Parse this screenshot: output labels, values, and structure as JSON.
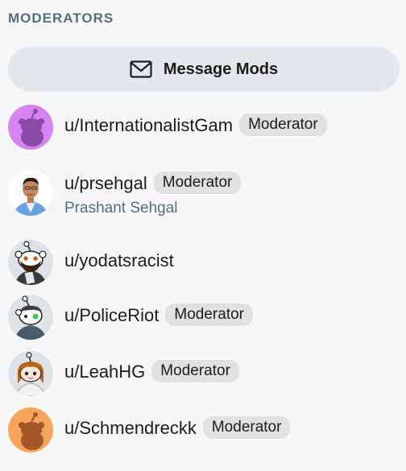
{
  "section": {
    "title": "MODERATORS"
  },
  "message_button": {
    "label": "Message Mods",
    "icon": "envelope-icon"
  },
  "moderators": [
    {
      "username": "u/InternationalistGam",
      "badge": "Moderator",
      "avatar_color": "#d584f0"
    },
    {
      "username": "u/prsehgal",
      "badge": "Moderator",
      "display_name": "Prashant Sehgal"
    },
    {
      "username": "u/yodatsracist"
    },
    {
      "username": "u/PoliceRiot",
      "badge": "Moderator"
    },
    {
      "username": "u/LeahHG",
      "badge": "Moderator"
    },
    {
      "username": "u/Schmendreckk",
      "badge": "Moderator",
      "avatar_color": "#f5a55c"
    }
  ]
}
